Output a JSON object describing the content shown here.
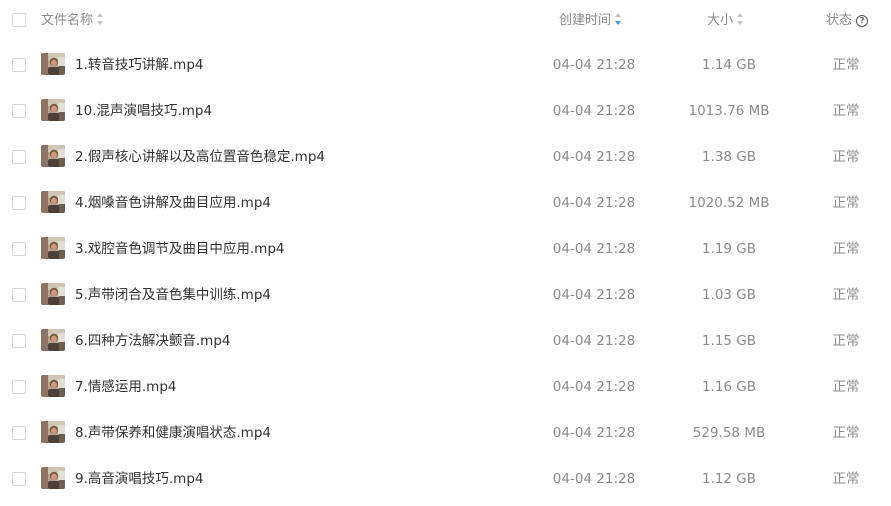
{
  "header": {
    "name_label": "文件名称",
    "created_label": "创建时间",
    "size_label": "大小",
    "status_label": "状态",
    "help_glyph": "?"
  },
  "files": [
    {
      "name": "1.转音技巧讲解.mp4",
      "created": "04-04 21:28",
      "size": "1.14 GB",
      "status": "正常"
    },
    {
      "name": "10.混声演唱技巧.mp4",
      "created": "04-04 21:28",
      "size": "1013.76 MB",
      "status": "正常"
    },
    {
      "name": "2.假声核心讲解以及高位置音色稳定.mp4",
      "created": "04-04 21:28",
      "size": "1.38 GB",
      "status": "正常"
    },
    {
      "name": "4.烟嗓音色讲解及曲目应用.mp4",
      "created": "04-04 21:28",
      "size": "1020.52 MB",
      "status": "正常"
    },
    {
      "name": "3.戏腔音色调节及曲目中应用.mp4",
      "created": "04-04 21:28",
      "size": "1.19 GB",
      "status": "正常"
    },
    {
      "name": "5.声带闭合及音色集中训练.mp4",
      "created": "04-04 21:28",
      "size": "1.03 GB",
      "status": "正常"
    },
    {
      "name": "6.四种方法解决颤音.mp4",
      "created": "04-04 21:28",
      "size": "1.15 GB",
      "status": "正常"
    },
    {
      "name": "7.情感运用.mp4",
      "created": "04-04 21:28",
      "size": "1.16 GB",
      "status": "正常"
    },
    {
      "name": "8.声带保养和健康演唱状态.mp4",
      "created": "04-04 21:28",
      "size": "529.58 MB",
      "status": "正常"
    },
    {
      "name": "9.高音演唱技巧.mp4",
      "created": "04-04 21:28",
      "size": "1.12 GB",
      "status": "正常"
    }
  ],
  "colors": {
    "active_sort": "#4a90f0",
    "muted_text": "#8c8c8c",
    "primary_text": "#333333"
  },
  "icons": {
    "thumbnail": "video-thumbnail-icon",
    "sort": "sort-arrows-icon",
    "help": "help-circle-icon"
  }
}
